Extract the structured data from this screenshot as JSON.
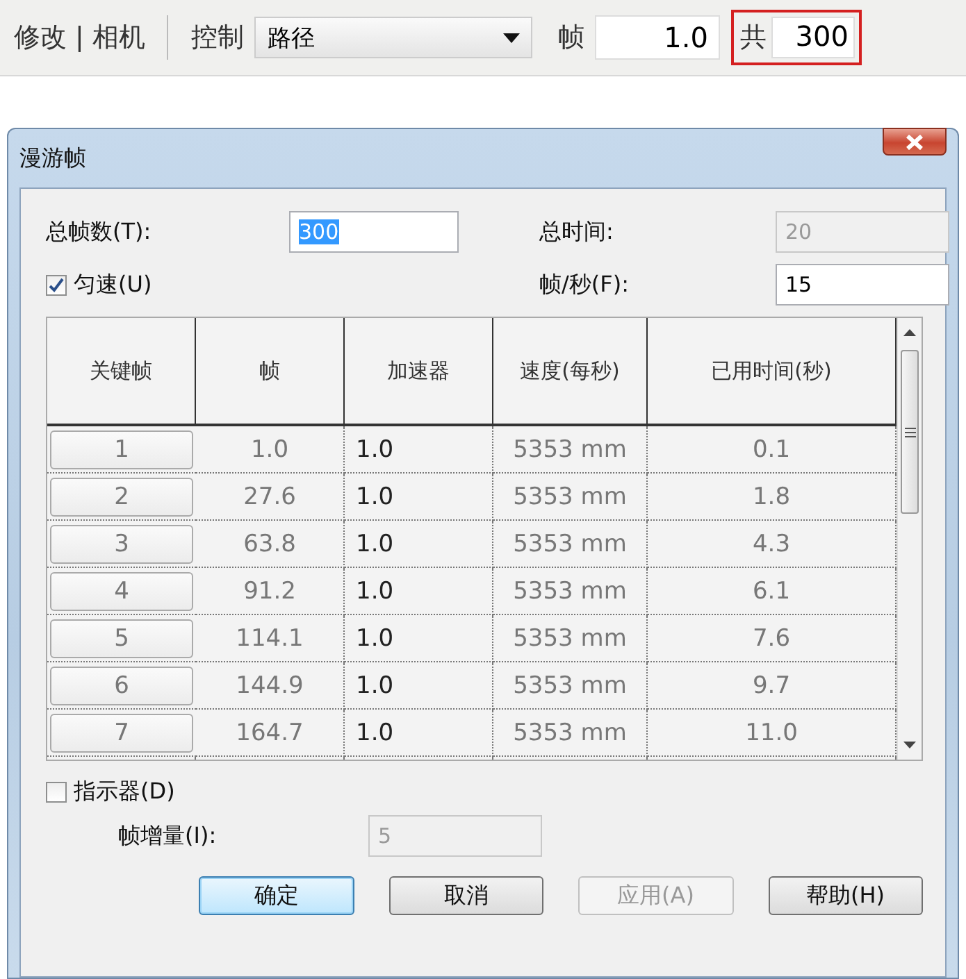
{
  "toolbar": {
    "title": "修改 | 相机",
    "control_label": "控制",
    "control_dropdown": {
      "value": "路径"
    },
    "frame_label": "帧",
    "frame_field": {
      "value": "1.0"
    },
    "total_label": "共",
    "total_field": {
      "value": "300"
    },
    "total_highlighted": true
  },
  "dialog": {
    "title": "漫游帧",
    "fields": [
      {
        "label": "总帧数(T):",
        "value": "300",
        "disabled": false,
        "highlighted": true
      },
      {
        "label": "总时间:",
        "value": "20",
        "disabled": true,
        "highlighted": false
      },
      {
        "label": "帧/秒(F):",
        "value": "15",
        "disabled": false,
        "highlighted": false
      }
    ],
    "uniform_speed": {
      "label": "匀速(U)",
      "checked": true
    },
    "table": {
      "columns": [
        "关键帧",
        "帧",
        "加速器",
        "速度(每秒)",
        "已用时间(秒)"
      ],
      "rows": [
        [
          "1",
          "1.0",
          "1.0",
          "5353 mm",
          "0.1"
        ],
        [
          "2",
          "27.6",
          "1.0",
          "5353 mm",
          "1.8"
        ],
        [
          "3",
          "63.8",
          "1.0",
          "5353 mm",
          "4.3"
        ],
        [
          "4",
          "91.2",
          "1.0",
          "5353 mm",
          "6.1"
        ],
        [
          "5",
          "114.1",
          "1.0",
          "5353 mm",
          "7.6"
        ],
        [
          "6",
          "144.9",
          "1.0",
          "5353 mm",
          "9.7"
        ],
        [
          "7",
          "164.7",
          "1.0",
          "5353 mm",
          "11.0"
        ]
      ]
    },
    "indicator": {
      "label": "指示器(D)",
      "checked": false
    },
    "increment": {
      "label": "帧增量(I):",
      "value": "5",
      "disabled": true
    },
    "buttons": [
      {
        "label": "确定",
        "default": true,
        "disabled": false
      },
      {
        "label": "取消",
        "default": false,
        "disabled": false
      },
      {
        "label": "应用(A)",
        "default": false,
        "disabled": true
      },
      {
        "label": "帮助(H)",
        "default": false,
        "disabled": false
      }
    ]
  }
}
